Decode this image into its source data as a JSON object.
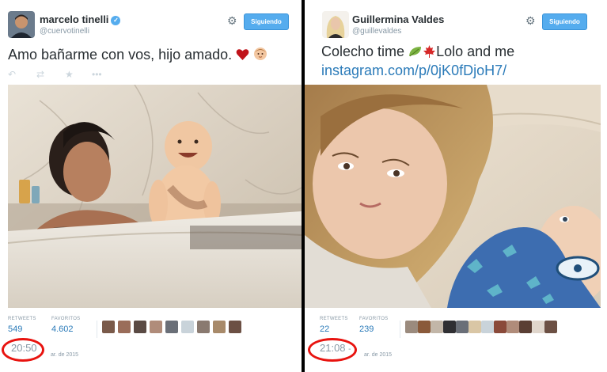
{
  "left_tweet": {
    "name": "marcelo tinelli",
    "handle": "@cuervotinelli",
    "verified": true,
    "follow_button": "Siguiendo",
    "text": "Amo bañarme con vos, hijo amado.",
    "emoji": [
      "red-heart",
      "baby-face"
    ],
    "retweets_label": "RETWEETS",
    "retweets": "549",
    "favorites_label": "FAVORITOS",
    "favorites": "4.602",
    "time": "20:50",
    "date": "ar. de 2015",
    "photo": "man-and-baby-in-marble-bathtub",
    "fav_avatar_count": 9
  },
  "right_tweet": {
    "name": "Guillermina Valdes",
    "handle": "@guillevaldes",
    "follow_button": "Siguiendo",
    "text": "Colecho time",
    "emoji": [
      "leaf",
      "maple-leaf"
    ],
    "text_after": "Lolo and me",
    "link": "instagram.com/p/0jK0fDjoH7/",
    "retweets_label": "RETWEETS",
    "retweets": "22",
    "favorites_label": "FAVORITOS",
    "favorites": "239",
    "time": "21:08",
    "time_suffix": "-",
    "date": "ar. de 2015",
    "photo": "woman-and-baby-in-bed-selfie",
    "fav_avatar_count": 12
  },
  "icons": {
    "reply": "reply-icon",
    "retweet": "retweet-icon",
    "favorite": "star-icon",
    "more": "more-icon",
    "settings": "gear-icon",
    "verified": "verified-badge-icon"
  },
  "colors": {
    "accent": "#55acee",
    "link": "#2b7bb9",
    "highlight_circle": "#e8130f",
    "heart": "#c0131a"
  }
}
